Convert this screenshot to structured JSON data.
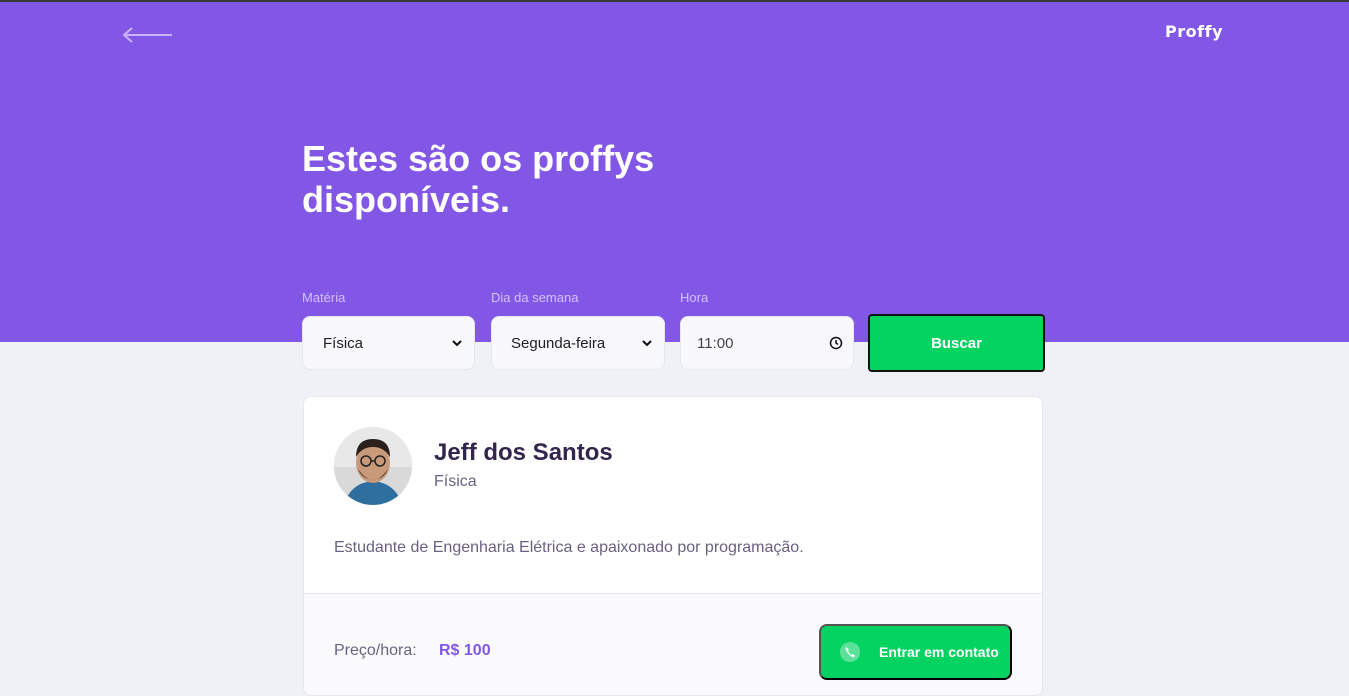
{
  "colors": {
    "primary": "#8257E5",
    "accent_green": "#04D361",
    "background": "#F0F0F7",
    "text_title": "#32264D",
    "text_muted": "#6A6180"
  },
  "header": {
    "back_icon": "arrow-left-icon",
    "logo": "Proffy",
    "title": "Estes são os proffys disponíveis."
  },
  "filters": {
    "subject_label": "Matéria",
    "subject_value": "Física",
    "weekday_label": "Dia da semana",
    "weekday_value": "Segunda-feira",
    "time_label": "Hora",
    "time_value": "11:00",
    "search_button": "Buscar"
  },
  "teacher": {
    "name": "Jeff dos Santos",
    "subject": "Física",
    "bio": "Estudante de Engenharia Elétrica e apaixonado por programação.",
    "price_label": "Preço/hora:",
    "price_value": "R$ 100",
    "contact_button": "Entrar em contato",
    "contact_icon": "whatsapp-icon"
  }
}
